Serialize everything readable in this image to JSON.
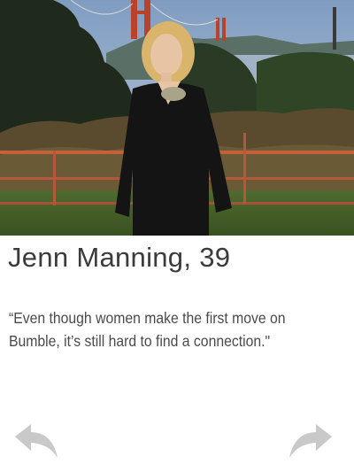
{
  "profile": {
    "name": "Jenn Manning",
    "separator": ", ",
    "age": "39",
    "quote": "“Even though women make the first move on Bumble, it’s still hard to find a connection.\""
  },
  "icons": {
    "back": "back-arrow-icon",
    "forward": "forward-arrow-icon"
  },
  "colors": {
    "text": "#3b3b3b",
    "arrow": "#c9c9c9"
  }
}
